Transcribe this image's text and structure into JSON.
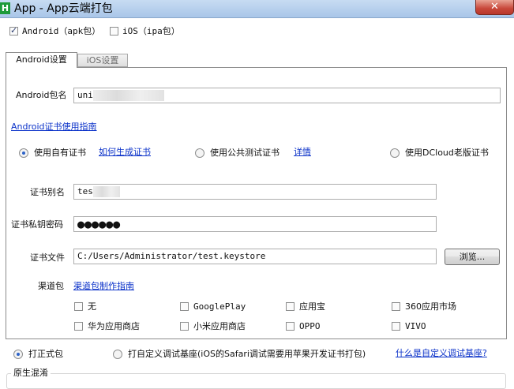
{
  "window": {
    "title": "App - App云端打包",
    "icon_letter": "H",
    "close": "✕"
  },
  "platforms": [
    {
      "label": "Android（apk包）",
      "checked": true
    },
    {
      "label": "iOS（ipa包）",
      "checked": false
    }
  ],
  "tabs": [
    {
      "label": "Android设置",
      "active": true
    },
    {
      "label": "iOS设置",
      "active": false
    }
  ],
  "android": {
    "package_label": "Android包名",
    "package_value": "uni",
    "cert_guide_link": "Android证书使用指南",
    "cert_options": [
      {
        "label": "使用自有证书",
        "checked": true,
        "link": "如何生成证书"
      },
      {
        "label": "使用公共测试证书",
        "checked": false,
        "link": "详情"
      },
      {
        "label": "使用DCloud老版证书",
        "checked": false
      }
    ],
    "alias_label": "证书别名",
    "alias_value": "tes",
    "password_label": "证书私钥密码",
    "password_value": "●●●●●●",
    "file_label": "证书文件",
    "file_value": "C:/Users/Administrator/test.keystore",
    "browse_button": "浏览...",
    "channel_label": "渠道包",
    "channel_link": "渠道包制作指南",
    "channels": [
      "无",
      "GooglePlay",
      "应用宝",
      "360应用市场",
      "华为应用商店",
      "小米应用商店",
      "OPPO",
      "VIVO"
    ]
  },
  "build_mode": {
    "release": {
      "label": "打正式包",
      "checked": true
    },
    "custom": {
      "label": "打自定义调试基座(iOS的Safari调试需要用苹果开发证书打包)",
      "checked": false
    },
    "custom_link": "什么是自定义调试基座?"
  },
  "native_obfuscation": {
    "label": "原生混淆"
  }
}
